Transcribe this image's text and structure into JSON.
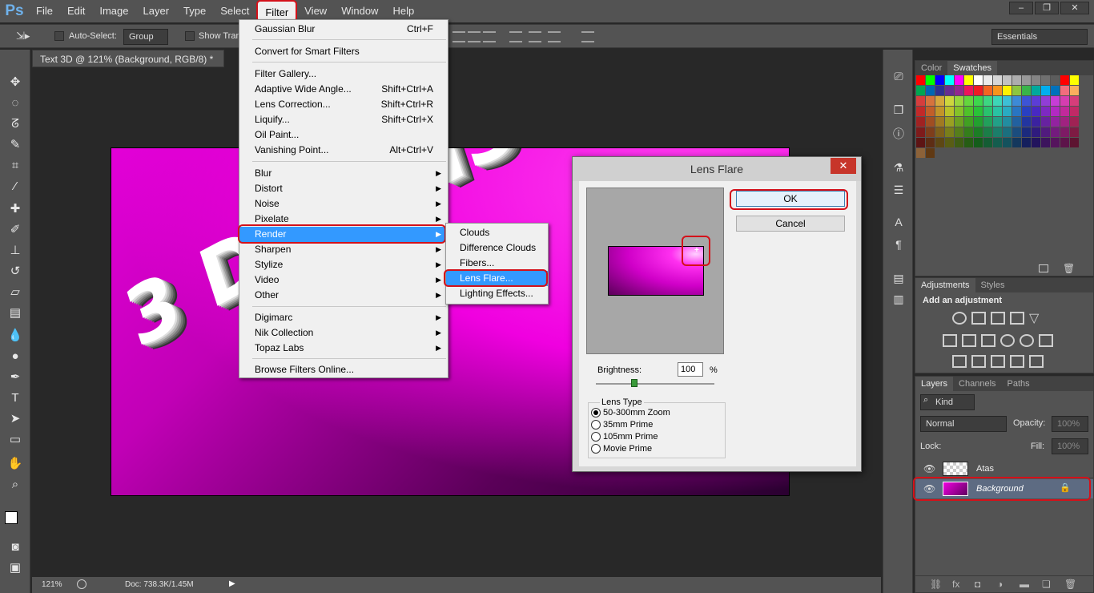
{
  "app": {
    "logo": "Ps"
  },
  "menubar": [
    "File",
    "Edit",
    "Image",
    "Layer",
    "Type",
    "Select",
    "Filter",
    "View",
    "Window",
    "Help"
  ],
  "window_controls": {
    "minimize": "–",
    "restore": "❐",
    "close": "✕"
  },
  "options": {
    "auto_select": "Auto-Select:",
    "group": "Group",
    "show_transform": "Show Tran",
    "workspace": "Essentials"
  },
  "document": {
    "tab": "Text 3D @ 121% (Background, RGB/8) *",
    "canvas_text": "3 DIMENSI",
    "zoom": "121%",
    "doc_info": "Doc: 738.3K/1.45M"
  },
  "filter_menu": {
    "items": [
      {
        "label": "Gaussian Blur",
        "shortcut": "Ctrl+F"
      },
      {
        "label": "Convert for Smart Filters",
        "shortcut": ""
      },
      {
        "label": "Filter Gallery...",
        "shortcut": ""
      },
      {
        "label": "Adaptive Wide Angle...",
        "shortcut": "Shift+Ctrl+A"
      },
      {
        "label": "Lens Correction...",
        "shortcut": "Shift+Ctrl+R"
      },
      {
        "label": "Liquify...",
        "shortcut": "Shift+Ctrl+X"
      },
      {
        "label": "Oil Paint...",
        "shortcut": ""
      },
      {
        "label": "Vanishing Point...",
        "shortcut": "Alt+Ctrl+V"
      },
      {
        "label": "Blur",
        "shortcut": ""
      },
      {
        "label": "Distort",
        "shortcut": ""
      },
      {
        "label": "Noise",
        "shortcut": ""
      },
      {
        "label": "Pixelate",
        "shortcut": ""
      },
      {
        "label": "Render",
        "shortcut": ""
      },
      {
        "label": "Sharpen",
        "shortcut": ""
      },
      {
        "label": "Stylize",
        "shortcut": ""
      },
      {
        "label": "Video",
        "shortcut": ""
      },
      {
        "label": "Other",
        "shortcut": ""
      },
      {
        "label": "Digimarc",
        "shortcut": ""
      },
      {
        "label": "Nik Collection",
        "shortcut": ""
      },
      {
        "label": "Topaz Labs",
        "shortcut": ""
      },
      {
        "label": "Browse Filters Online...",
        "shortcut": ""
      }
    ]
  },
  "render_submenu": [
    "Clouds",
    "Difference Clouds",
    "Fibers...",
    "Lens Flare...",
    "Lighting Effects..."
  ],
  "dialog": {
    "title": "Lens Flare",
    "close": "✕",
    "ok": "OK",
    "cancel": "Cancel",
    "brightness_label": "Brightness:",
    "brightness_value": "100",
    "brightness_unit": "%",
    "lens_type_label": "Lens Type",
    "lens_options": [
      "50-300mm Zoom",
      "35mm Prime",
      "105mm Prime",
      "Movie Prime"
    ],
    "selected_lens": "50-300mm Zoom"
  },
  "color_panel": {
    "tabs": [
      "Color",
      "Swatches"
    ]
  },
  "adjustments_panel": {
    "tabs": [
      "Adjustments",
      "Styles"
    ],
    "heading": "Add an adjustment"
  },
  "layers_panel": {
    "tabs": [
      "Layers",
      "Channels",
      "Paths"
    ],
    "kind": "Kind",
    "blend_mode": "Normal",
    "opacity_label": "Opacity:",
    "opacity_value": "100%",
    "lock_label": "Lock:",
    "fill_label": "Fill:",
    "fill_value": "100%",
    "layers": [
      {
        "name": "Atas",
        "selected": false
      },
      {
        "name": "Background",
        "selected": true
      }
    ]
  },
  "colors": {
    "accent": "#3399ff",
    "highlight": "#d4111a",
    "panel": "#535353"
  }
}
